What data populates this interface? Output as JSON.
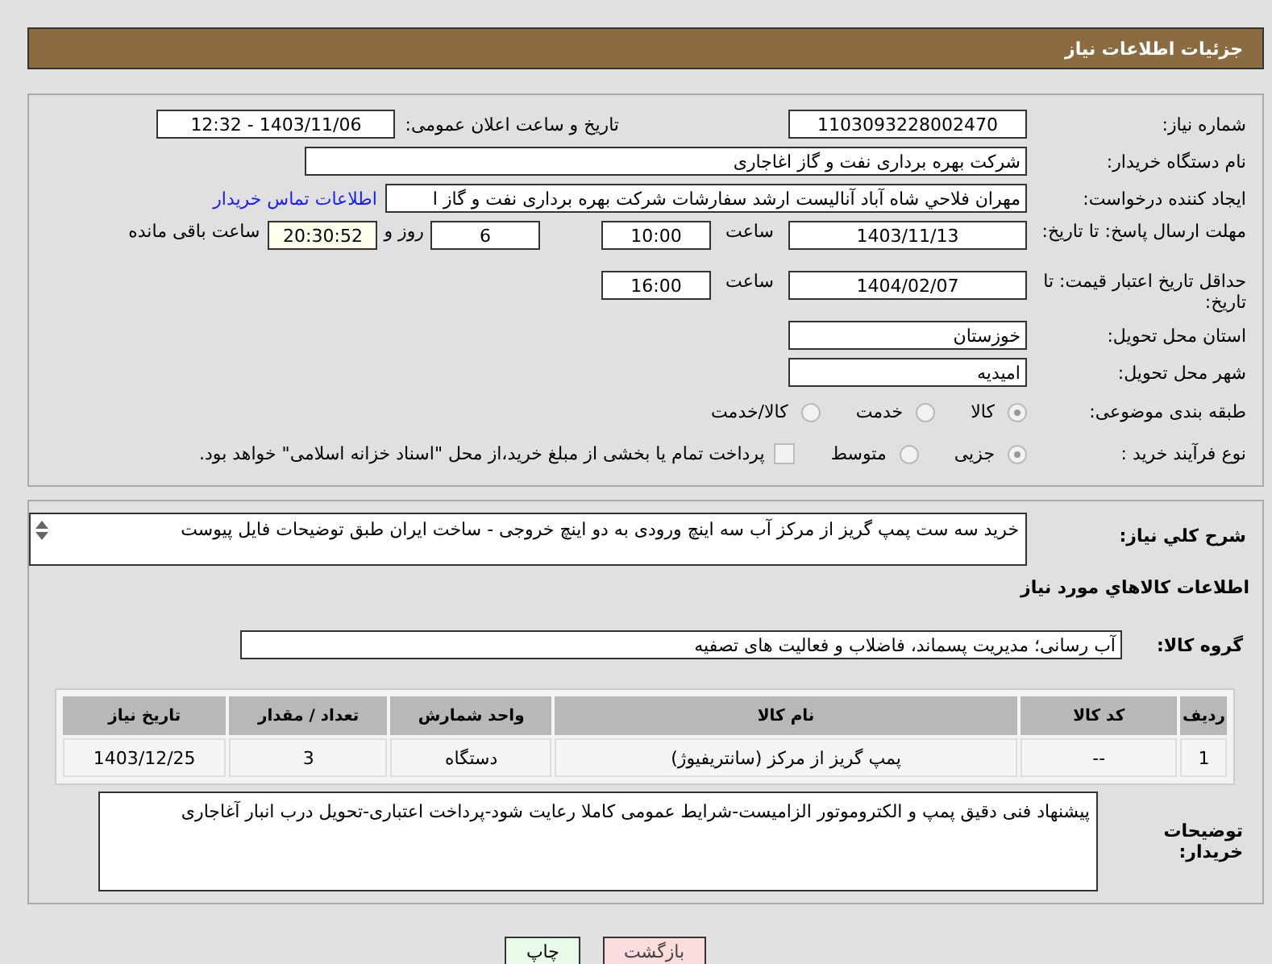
{
  "header": {
    "title": "جزئیات اطلاعات نیاز"
  },
  "need_number": {
    "label": "شماره نیاز:",
    "value": "1103093228002470"
  },
  "announce": {
    "label": "تاریخ و ساعت اعلان عمومی:",
    "value": "1403/11/06 - 12:32"
  },
  "buyer_org": {
    "label": "نام دستگاه خریدار:",
    "value": "شرکت بهره برداری نفت و گاز اغاجاری"
  },
  "requester": {
    "label": "ایجاد کننده درخواست:",
    "value": "مهران فلاحي شاه آباد آناليست ارشد سفارشات شرکت بهره برداری نفت و گاز ا",
    "link": "اطلاعات تماس خریدار"
  },
  "reply_deadline": {
    "label": "مهلت ارسال پاسخ: تا تاریخ:",
    "date": "1403/11/13",
    "time_label": "ساعت",
    "time": "10:00",
    "days": "6",
    "days_label": "روز و",
    "remaining": "20:30:52",
    "remaining_label": "ساعت باقی مانده"
  },
  "price_validity": {
    "label": "حداقل تاریخ اعتبار قیمت: تا تاریخ:",
    "date": "1404/02/07",
    "time_label": "ساعت",
    "time": "16:00"
  },
  "province": {
    "label": "استان محل تحویل:",
    "value": "خوزستان"
  },
  "city": {
    "label": "شهر محل تحویل:",
    "value": "امیدیه"
  },
  "category": {
    "label": "طبقه بندی موضوعی:",
    "options": [
      {
        "label": "کالا",
        "selected": true
      },
      {
        "label": "خدمت",
        "selected": false
      },
      {
        "label": "کالا/خدمت",
        "selected": false
      }
    ]
  },
  "purchase_type": {
    "label": "نوع فرآیند خرید :",
    "options": [
      {
        "label": "جزیی",
        "selected": true
      },
      {
        "label": "متوسط",
        "selected": false
      }
    ],
    "payment": {
      "checked": false,
      "text": "پرداخت تمام یا بخشی از مبلغ خرید،از محل \"اسناد خزانه اسلامی\" خواهد بود."
    }
  },
  "description": {
    "label": "شرح کلي نياز:",
    "value": "خرید سه ست پمپ گریز از مرکز آب سه اینچ ورودی به دو اینچ خروجی - ساخت ایران طبق توضیحات فایل پیوست"
  },
  "goods_heading": "اطلاعات کالاهاي مورد نياز",
  "goods_group": {
    "label": "گروه کالا:",
    "value": "آب رسانی؛ مدیریت پسماند، فاضلاب و فعالیت های تصفیه"
  },
  "table": {
    "columns": [
      "ردیف",
      "کد کالا",
      "نام کالا",
      "واحد شمارش",
      "تعداد / مقدار",
      "تاریخ نیاز"
    ],
    "rows": [
      [
        "1",
        "--",
        "پمپ گریز از مرکز (سانتریفیوژ)",
        "دستگاه",
        "3",
        "1403/12/25"
      ]
    ]
  },
  "buyer_notes": {
    "label": "توضیحات خریدار:",
    "value": "پیشنهاد فنی دقیق پمپ و الکتروموتور الزامیست-شرایط عمومی کاملا رعایت شود-پرداخت اعتباری-تحویل درب انبار آغاجاری"
  },
  "buttons": [
    {
      "kind": "back",
      "label": "بازگشت"
    },
    {
      "kind": "print",
      "label": "چاپ"
    }
  ]
}
